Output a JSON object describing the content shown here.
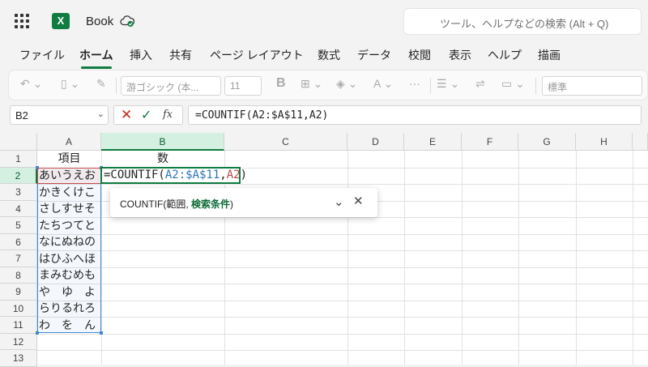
{
  "app": {
    "title": "Book",
    "search_placeholder": "ツール、ヘルプなどの検索 (Alt + Q)"
  },
  "tabs": [
    {
      "label": "ファイル"
    },
    {
      "label": "ホーム"
    },
    {
      "label": "挿入"
    },
    {
      "label": "共有"
    },
    {
      "label": "ページ レイアウト"
    },
    {
      "label": "数式"
    },
    {
      "label": "データ"
    },
    {
      "label": "校閲"
    },
    {
      "label": "表示"
    },
    {
      "label": "ヘルプ"
    },
    {
      "label": "描画"
    }
  ],
  "active_tab": "ホーム",
  "ribbon": {
    "font_name": "游ゴシック (本...",
    "font_size": "11",
    "bold": "B",
    "number_format": "標準"
  },
  "formula_bar": {
    "name_box": "B2",
    "formula": "=COUNTIF(A2:$A$11,A2)",
    "fx_label": "fx"
  },
  "grid": {
    "columns": [
      "A",
      "B",
      "C",
      "D",
      "E",
      "F",
      "G",
      "H"
    ],
    "rows": [
      "1",
      "2",
      "3",
      "4",
      "5",
      "6",
      "7",
      "8",
      "9",
      "10",
      "11",
      "12",
      "13"
    ],
    "selected_column": "B",
    "selected_row": "2",
    "header_a": "項目",
    "header_b": "数",
    "column_a_values": [
      "あいうえお",
      "かきくけこ",
      "さしすせそ",
      "たちつてと",
      "なにぬねの",
      "はひふへほ",
      "まみむめも",
      "や　ゆ　よ",
      "らりるれろ",
      "わ　を　ん"
    ],
    "edit_cell": {
      "prefix": "=COUNTIF(",
      "range": "A2:$A$11",
      "comma": ",",
      "ref": "A2",
      "suffix": ")"
    }
  },
  "tooltip": {
    "func": "COUNTIF(",
    "arg1": "範囲, ",
    "arg2": "検索条件",
    "close": ")"
  },
  "colors": {
    "excel_green": "#107c41",
    "range_blue": "#3d8bd4",
    "ref_red": "#c74d4d"
  }
}
